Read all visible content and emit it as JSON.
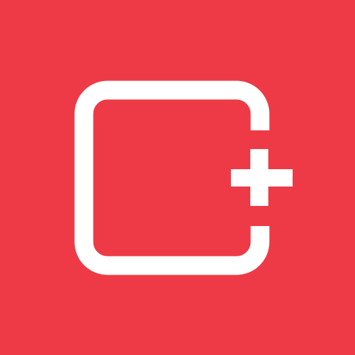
{
  "icon": {
    "name": "add-frame-icon",
    "glyph": "rounded-square-with-plus",
    "background_color": "#ee3a46",
    "foreground_color": "#ffffff"
  }
}
